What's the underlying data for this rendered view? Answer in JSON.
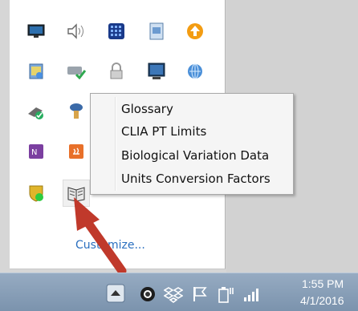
{
  "tray": {
    "customize_label": "Customize..."
  },
  "context_menu": {
    "items": [
      "Glossary",
      "CLIA PT Limits",
      "Biological Variation Data",
      "Units Conversion Factors"
    ]
  },
  "clock": {
    "time": "1:55 PM",
    "date": "4/1/2016"
  },
  "icons": {
    "row1": [
      "monitor-icon",
      "speaker-icon",
      "grid-app-icon",
      "document-icon",
      "update-arrow-icon"
    ],
    "row2": [
      "notepad-icon",
      "network-check-icon",
      "lock-icon",
      "display-icon",
      "globe-icon"
    ],
    "row3": [
      "shield-check-icon",
      "funnel-icon"
    ],
    "row4": [
      "onenote-icon",
      "java-icon"
    ],
    "row5": [
      "security-shield-icon",
      "book-reference-icon"
    ],
    "taskbar": [
      "show-hidden-icon",
      "camera-icon",
      "dropbox-icon",
      "flag-icon",
      "battery-plug-icon",
      "signal-icon"
    ]
  },
  "colors": {
    "accent_arrow": "#c0392b",
    "link": "#2a6fbf",
    "taskbar": "#8aa1ba"
  }
}
